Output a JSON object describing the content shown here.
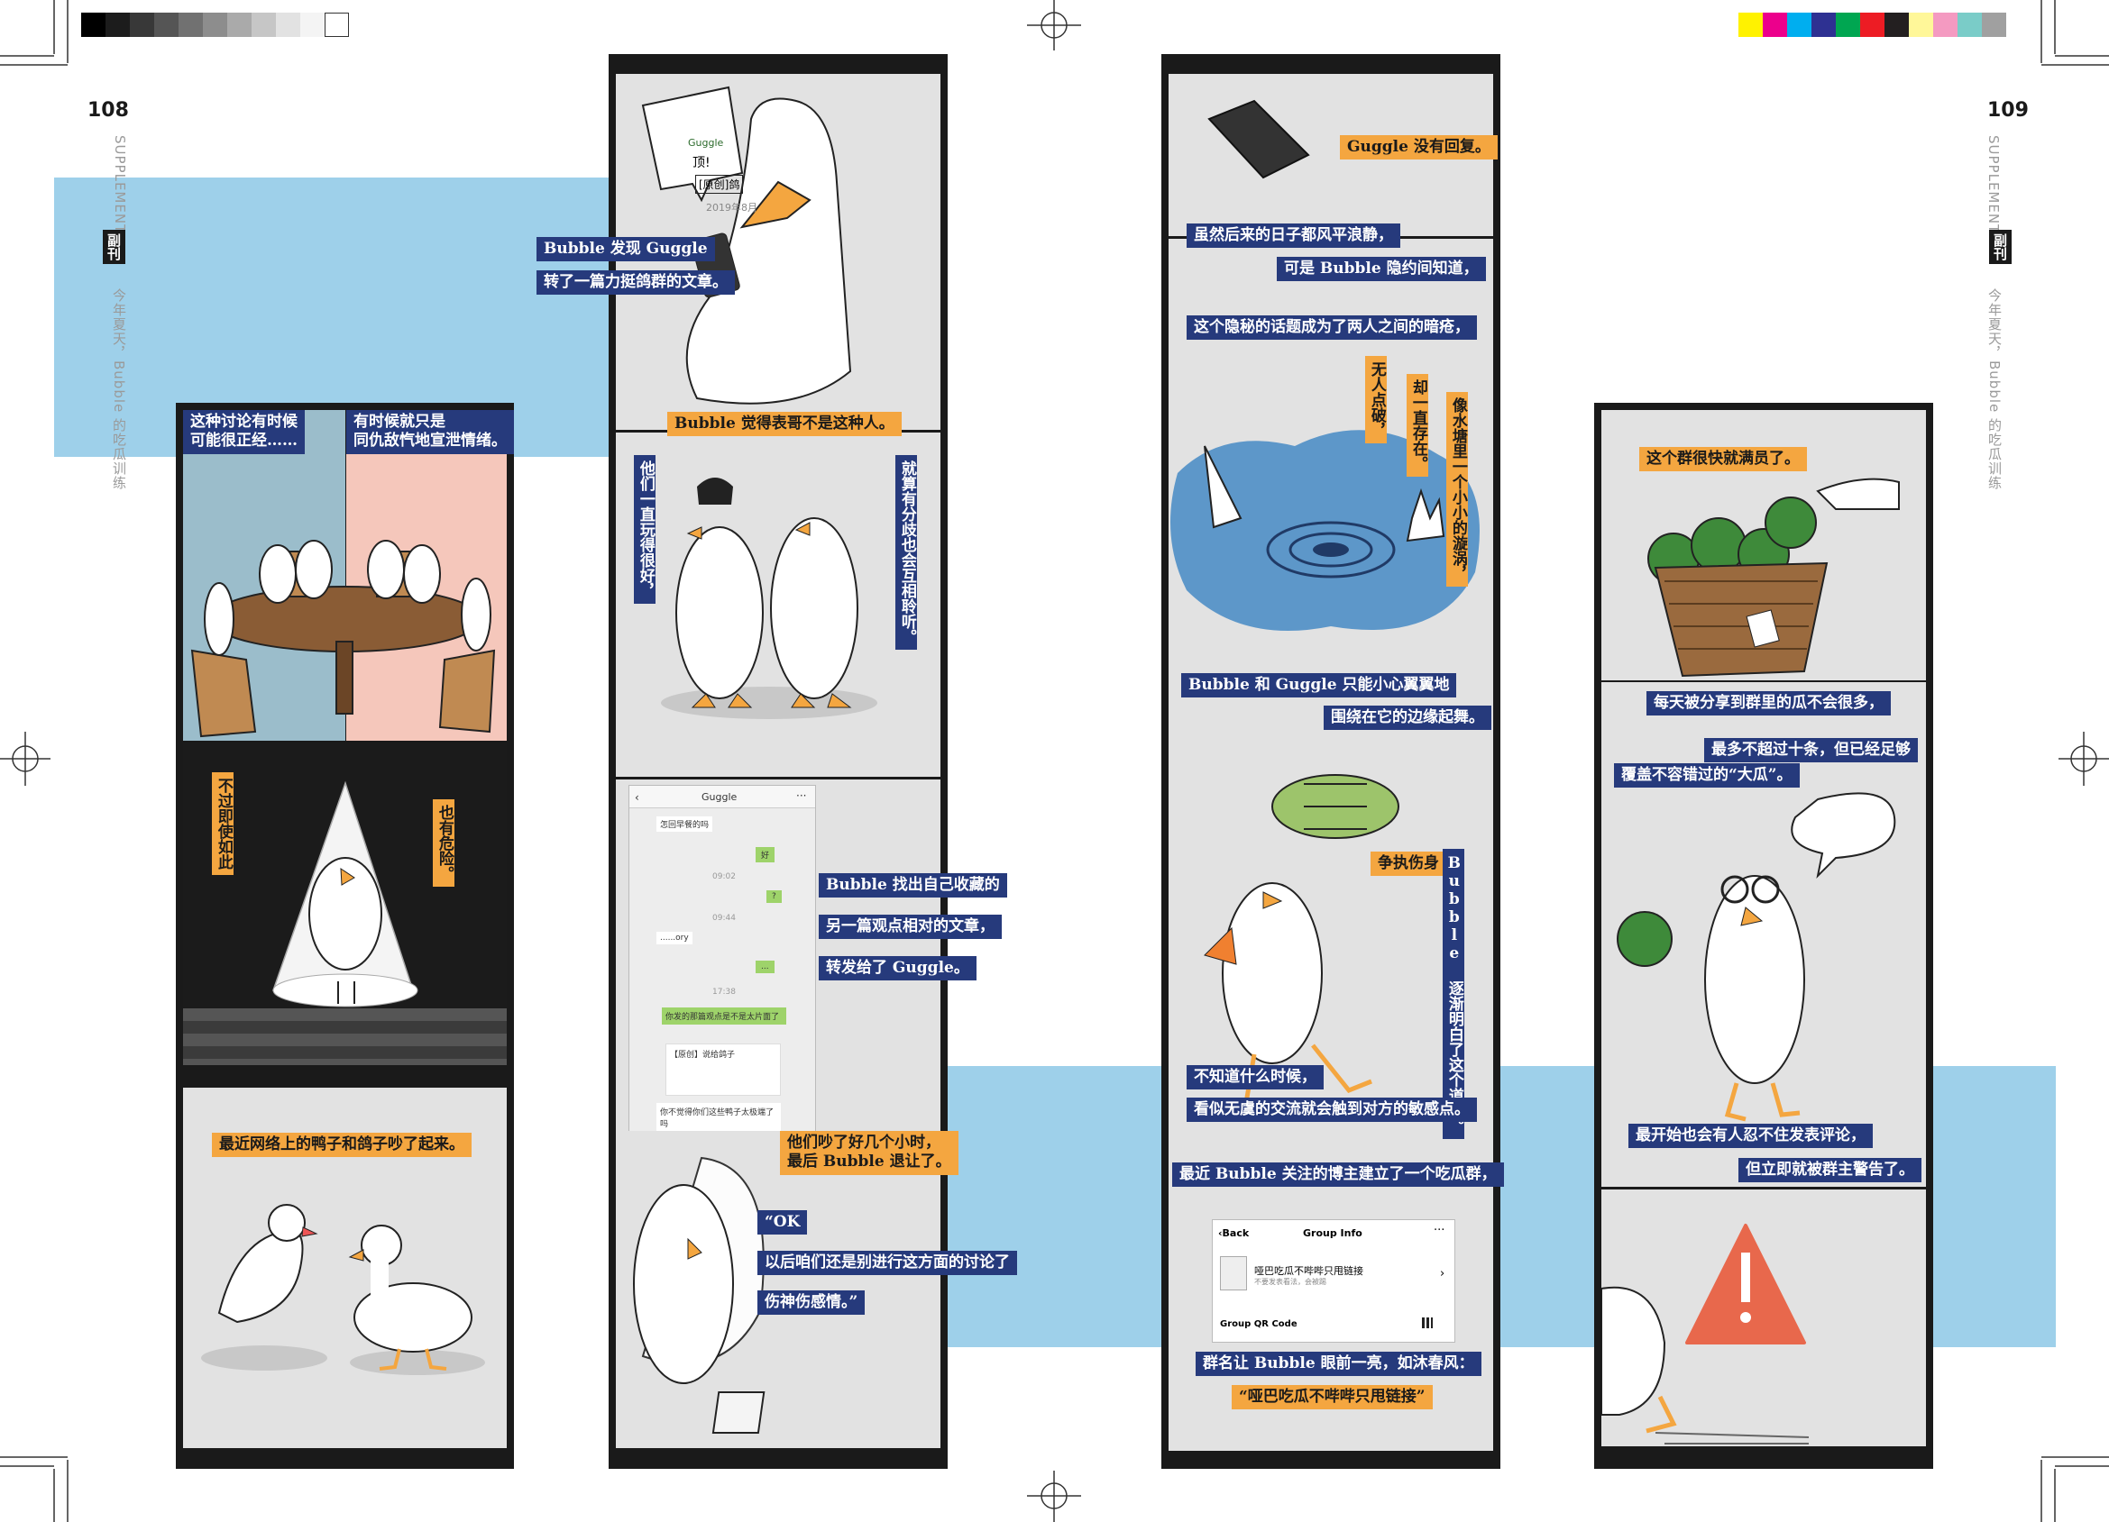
{
  "page_left": {
    "number": "108",
    "section": "SUPPLEMENT",
    "badge": "副刊",
    "subtitle": "今年夏天，Bubble 的吃瓜训练"
  },
  "page_right": {
    "number": "109",
    "section": "SUPPLEMENT",
    "badge": "副刊",
    "subtitle": "今年夏天，Bubble 的吃瓜训练"
  },
  "colors": {
    "blue_band": "#9ed0ea",
    "caption_blue": "#263a7c",
    "caption_orange": "#f4a640",
    "strip_frame": "#1a1a1a",
    "panel_grey": "#e2e2e2",
    "warning_red": "#e8684c"
  },
  "strip1": {
    "cap_left": "这种讨论有时候\n可能很正经……",
    "cap_right": "有时候就只是\n同仇敌忾地宣泄情绪。",
    "cap_v1": "不过即使如此",
    "cap_v2": "也有危险。",
    "cap_bottom": "最近网络上的鸭子和鸽子吵了起来。"
  },
  "strip2": {
    "note_user": "Guggle",
    "note_line1": "顶!",
    "note_tag": "[原创]鸽",
    "note_date": "2019年8月",
    "cap_found1": "Bubble 发现 Guggle",
    "cap_found2": "转了一篇力挺鸽群的文章。",
    "cap_think": "Bubble 觉得表哥不是这种人。",
    "cap_v_left": "他们一直玩得很好，",
    "cap_v_right": "就算有分歧也会互相聆听。",
    "chat_title": "Guggle",
    "chat_msgs": [
      "怎回早餐的吗",
      "好",
      "09:02",
      "?",
      "09:44",
      "......ory",
      "...",
      "17:38",
      "你发的那篇观点是不是太片面了",
      "【原创】说给鸽子",
      "你不觉得你们这些鸭子太极端了吗"
    ],
    "cap_reply1": "Bubble 找出自己收藏的",
    "cap_reply2": "另一篇观点相对的文章，",
    "cap_reply3": "转发给了 Guggle。",
    "cap_quarrel": "他们吵了好几个小时，\n最后 Bubble 退让了。",
    "cap_ok1": "“OK",
    "cap_ok2": "以后咱们还是别进行这方面的讨论了",
    "cap_ok3": "伤神伤感情。”"
  },
  "strip3": {
    "cap_noreply": "Guggle 没有回复。",
    "cap_calm1": "虽然后来的日子都风平浪静，",
    "cap_calm2": "可是 Bubble 隐约间知道，",
    "cap_scar": "这个隐秘的话题成为了两人之间的暗疮，",
    "cap_v_a": "像水塘里一个小小的漩涡，",
    "cap_v_b": "却一直存在。",
    "cap_v_c": "无人点破，",
    "cap_edge1": "Bubble 和 Guggle 只能小心翼翼地",
    "cap_edge2": "围绕在它的边缘起舞。",
    "cap_hurt": "争执伤身",
    "cap_v_learn": "Bubble 逐渐明白了这个道理。",
    "cap_touch1": "不知道什么时候，",
    "cap_touch2": "看似无虞的交流就会触到对方的敏感点。",
    "cap_group": "最近 Bubble 关注的博主建立了一个吃瓜群，",
    "group_back": "Back",
    "group_title": "Group Info",
    "group_name": "哑巴吃瓜不哔哔只甩链接",
    "group_sub": "不要发表看法，会被踢",
    "group_qr": "Group QR Code",
    "cap_name1": "群名让 Bubble 眼前一亮，如沐春风：",
    "cap_name2": "“哑巴吃瓜不哔哔只甩链接”"
  },
  "strip4": {
    "cap_full": "这个群很快就满员了。",
    "cap_share1": "每天被分享到群里的瓜不会很多，",
    "cap_share2": "最多不超过十条，但已经足够",
    "cap_share3": "覆盖不容错过的“大瓜”。",
    "cap_warn1": "最开始也会有人忍不住发表评论，",
    "cap_warn2": "但立即就被群主警告了。"
  }
}
